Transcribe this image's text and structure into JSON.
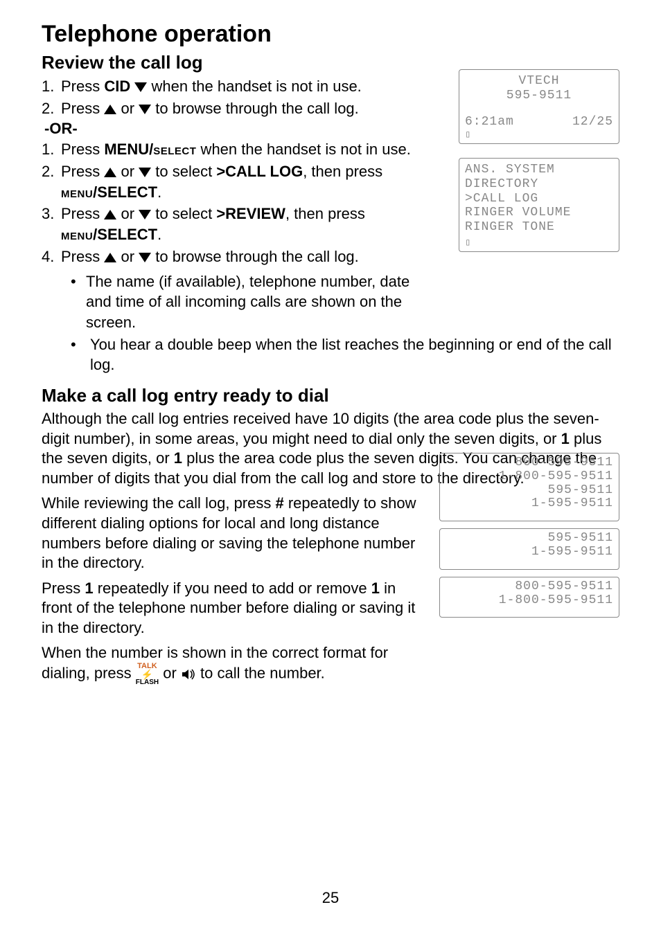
{
  "title": "Telephone operation",
  "section1": {
    "heading": "Review the call log",
    "step1_pre": "Press ",
    "step1_key": "CID ",
    "step1_post": " when the handset is not in use.",
    "step2_pre": "Press ",
    "step2_mid": " or ",
    "step2_post": " to browse through the call log.",
    "or": "-OR-",
    "alt1_pre": "Press ",
    "alt1_key": "MENU/",
    "alt1_key2": "select",
    "alt1_post": " when the handset is not in use.",
    "alt2_pre": "Press ",
    "alt2_mid": " or ",
    "alt2_sel": " to select ",
    "alt2_target": ">CALL LOG",
    "alt2_then": ", then press ",
    "alt2_menu": "menu",
    "alt2_select": "/SELECT",
    "alt2_end": ".",
    "alt3_pre": "Press ",
    "alt3_mid": " or ",
    "alt3_sel": " to select ",
    "alt3_target": ">REVIEW",
    "alt3_then": ", then press ",
    "alt3_menu": "menu",
    "alt3_select": "/SELECT",
    "alt3_end": ".",
    "alt4_pre": "Press ",
    "alt4_mid": " or ",
    "alt4_post": " to browse through the call log.",
    "bullet1": "The name (if available), telephone number, date and time of all incoming calls are shown on the screen.",
    "bullet2": "You hear a double beep when the list reaches the beginning or end of the call log."
  },
  "section2": {
    "heading": "Make a call log entry ready to dial",
    "p1": "Although the call log entries received have 10 digits (the area code plus the seven-digit number), in some areas, you might need to dial only the seven digits, or 1 plus the seven digits, or 1 plus the area code plus the seven digits. You can change the number of digits that you dial from the call log and store to the directory.",
    "p1_b1": "1",
    "p1_b2": "1",
    "p2_pre": "While reviewing the call log, press ",
    "p2_key": "#",
    "p2_post": " repeatedly to show different dialing options for local and long distance numbers before dialing or saving the telephone number in the directory.",
    "p3_pre": "Press ",
    "p3_key1": "1",
    "p3_mid": " repeatedly if you need to add or remove ",
    "p3_key2": "1",
    "p3_post": " in front of the telephone number before dialing or saving it in the directory.",
    "p4_pre": "When the number is shown in the correct format for dialing, press ",
    "p4_mid": " or ",
    "p4_post": " to call the number.",
    "talk_top": "TALK",
    "talk_bot": "FLASH"
  },
  "screen1": {
    "line1": "VTECH",
    "line2": "595-9511",
    "time": "6:21am",
    "date": "12/25"
  },
  "screen2": {
    "l1": " ANS. SYSTEM",
    "l2": " DIRECTORY",
    "l3": ">CALL LOG",
    "l4": " RINGER VOLUME",
    "l5": " RINGER TONE"
  },
  "mini1": {
    "a": "800-595-9511",
    "b": "1-800-595-9511",
    "c": "595-9511",
    "d": "1-595-9511"
  },
  "mini2": {
    "a": "595-9511",
    "b": "1-595-9511"
  },
  "mini3": {
    "a": "800-595-9511",
    "b": "1-800-595-9511"
  },
  "pageNumber": "25"
}
